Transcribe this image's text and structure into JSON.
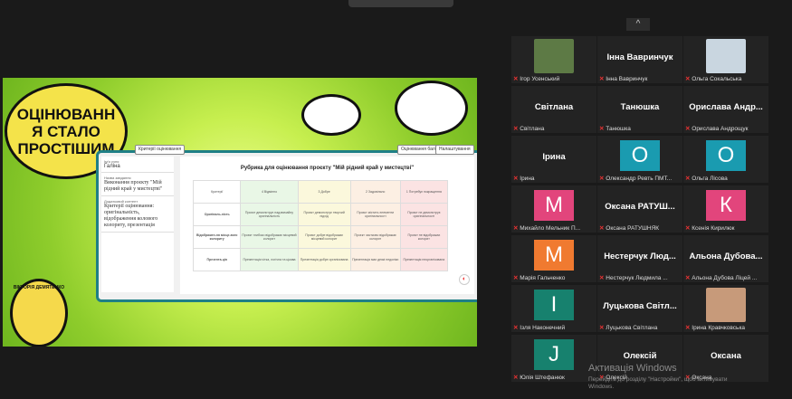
{
  "share": {
    "bubble": [
      "ОЦІНЮВАНН",
      "Я СТАЛО",
      "ПРОСТІШИМ"
    ],
    "panel": {
      "btn_left": "Критерії оцінювання",
      "btn_right1": "Оцінювання балів",
      "btn_right2": "Налаштування",
      "left": {
        "a_small": "Ім'я учня",
        "a": "Галіна",
        "b_small": "Назва завдання",
        "b": "Виконання проєкту \"Мій рідний край у мистецтві\"",
        "c_small": "Додатковий контент",
        "c": "Критерії оцінювання: оригінальність, відображення колового колориту, презентація"
      },
      "rubric_title": "Рубрика для оцінювання проєкту \"Мій рідний край у мистецтві\"",
      "header": [
        "Критерії",
        "4\nВідмінно",
        "3\nДобре",
        "2\nЗадовільно",
        "1\nПотребує покращення"
      ],
      "rows": [
        [
          "Оригіналь-ність",
          "Проєкт демонструє надзвичайну оригінальність",
          "Проєкт демонструє творчий підхід",
          "Проєкт містить елементи оригінальності",
          "Проєкт не демонструє оригінальності"
        ],
        [
          "Відображен-ня місце-вого колориту",
          "Проєкт глибоко відображає місцевий колорит",
          "Проєкт добре відображає місцевий колорит",
          "Проєкт частково відображає колорит",
          "Проєкт не відображає колорит"
        ],
        [
          "Презента-ція",
          "Презентація чітка, логічна та цікава",
          "Презентація добре організована",
          "Презентація має деякі недоліки",
          "Презентація неорганізована"
        ]
      ],
      "logo": "ВІКТОРІЯ ДЕМЯТЕНКО"
    }
  },
  "participants": [
    {
      "label": "Ігор Усенський",
      "name": "",
      "type": "photo",
      "color": "#5d7a45"
    },
    {
      "label": "Інна Вавринчук",
      "name": "Інна Вавринчук",
      "type": "name"
    },
    {
      "label": "Ольга Сокальська",
      "name": "",
      "type": "photo",
      "color": "#c9d6e0"
    },
    {
      "label": "Світлана",
      "name": "Світлана",
      "type": "name"
    },
    {
      "label": "Танюшка",
      "name": "Танюшка",
      "type": "name"
    },
    {
      "label": "Орислава Андрощук",
      "name": "Орислава Андр...",
      "type": "name"
    },
    {
      "label": "Ірина",
      "name": "Ірина",
      "type": "name"
    },
    {
      "label": "Олександр Ревть ПМТ...",
      "name": "О",
      "type": "avatar",
      "color": "#1a9bb0"
    },
    {
      "label": "Ольга Лісова",
      "name": "О",
      "type": "avatar",
      "color": "#1a9bb0"
    },
    {
      "label": "Михайло Мельник П...",
      "name": "М",
      "type": "avatar",
      "color": "#e2457c"
    },
    {
      "label": "Оксана РАТУШНЯК",
      "name": "Оксана РАТУШ...",
      "type": "name"
    },
    {
      "label": "Ксенія Кирилюк",
      "name": "К",
      "type": "avatar",
      "color": "#e2457c"
    },
    {
      "label": "Марія Гальченко",
      "name": "М",
      "type": "avatar",
      "color": "#f07a30"
    },
    {
      "label": "Нестерчук Людмила ...",
      "name": "Нестерчук Люд...",
      "type": "name"
    },
    {
      "label": "Альона Дубова Ліцей ...",
      "name": "Альона Дубова...",
      "type": "name"
    },
    {
      "label": "Ізля Наконечний",
      "name": "І",
      "type": "avatar",
      "color": "#17816e"
    },
    {
      "label": "Луцькова Світлана",
      "name": "Луцькова Світл...",
      "type": "name"
    },
    {
      "label": "Ірина Кравчковська",
      "name": "",
      "type": "photo",
      "color": "#c79a7a"
    },
    {
      "label": "Юлія Штефанюк",
      "name": "J",
      "type": "avatar",
      "color": "#17816e"
    },
    {
      "label": "Олексій",
      "name": "Олексій",
      "type": "name"
    },
    {
      "label": "Оксана",
      "name": "Оксана",
      "type": "name"
    }
  ],
  "collapse_label": "^",
  "watermark": {
    "title": "Активація Windows",
    "line1": "Перейдіть до розділу \"Настройки\", щоб активувати",
    "line2": "Windows."
  }
}
